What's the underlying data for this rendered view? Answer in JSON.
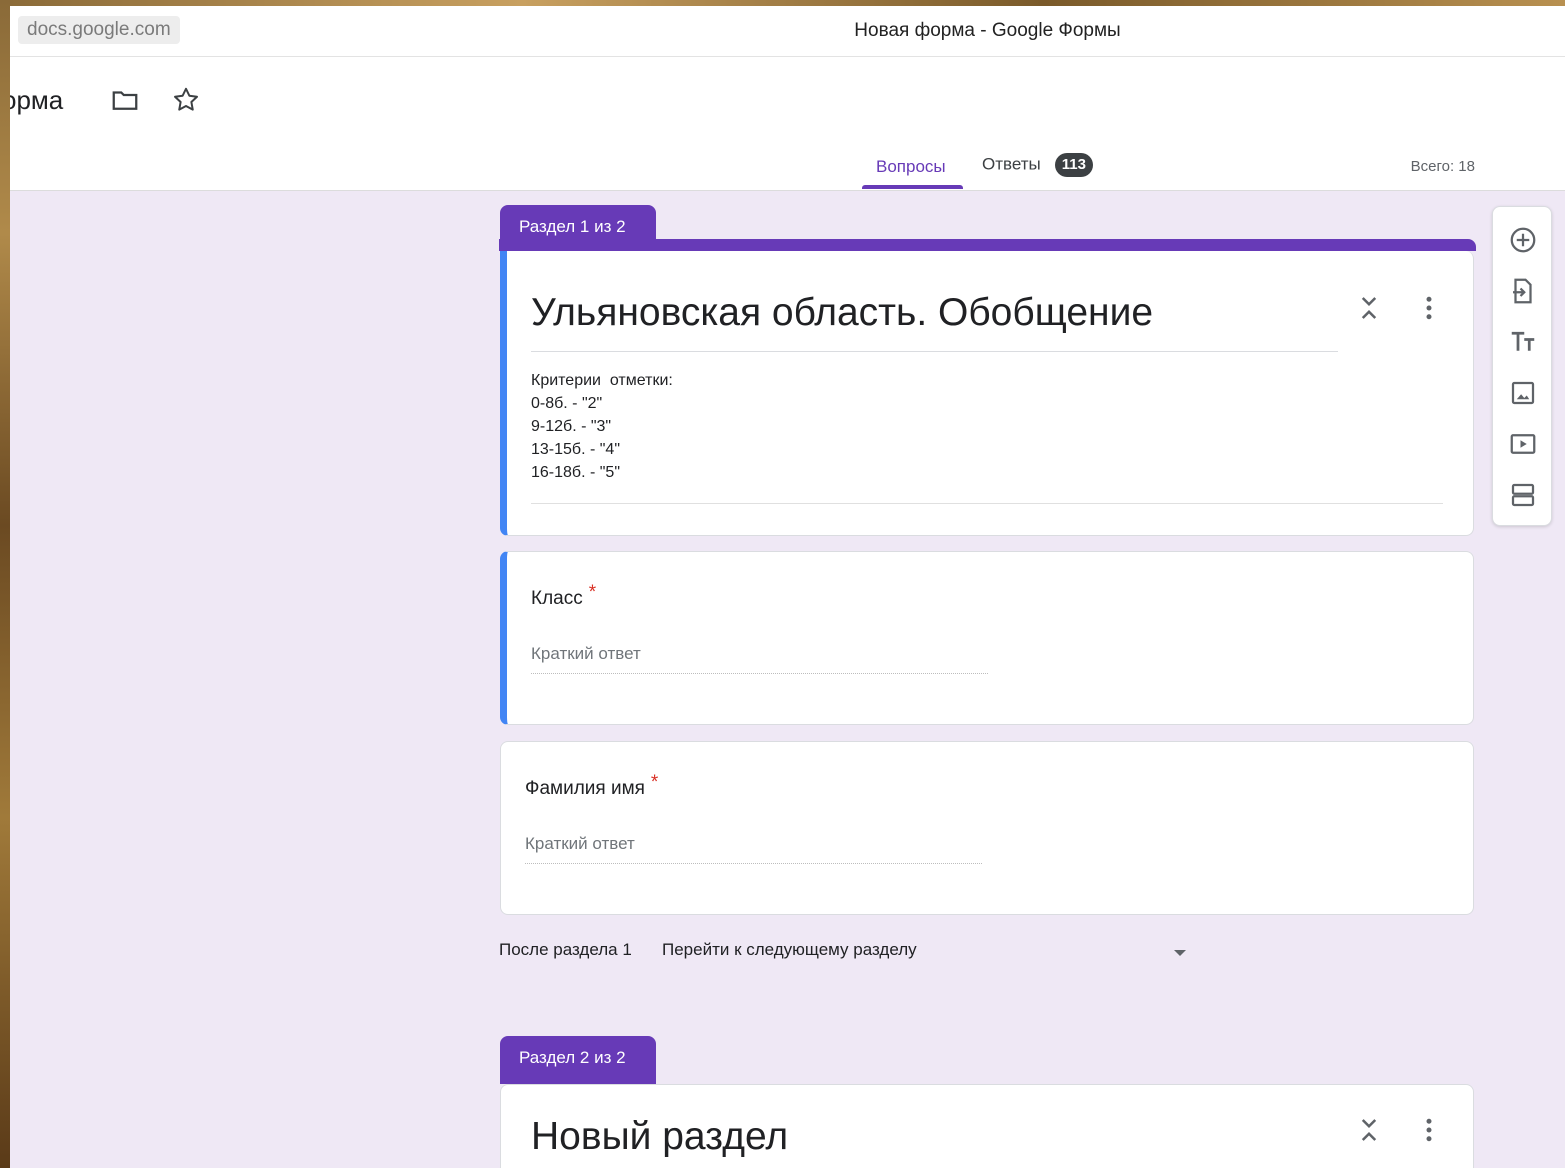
{
  "browser": {
    "url": "docs.google.com",
    "window_title": "Новая форма - Google Формы"
  },
  "header": {
    "doc_title": "орма",
    "folder_icon": "folder-icon",
    "star_icon": "star-icon",
    "tabs": [
      {
        "label": "Вопросы",
        "active": true
      },
      {
        "label": "Ответы",
        "badge": "113"
      }
    ],
    "total": "Всего: 18"
  },
  "section1": {
    "label": "Раздел 1 из 2",
    "title": "Ульяновская область. Обобщение",
    "description": [
      "Критерии  отметки:",
      "0-8б. - \"2\"",
      "9-12б. - \"3\"",
      "13-15б. - \"4\"",
      "16-18б. - \"5\""
    ]
  },
  "questions": [
    {
      "title": "Класс",
      "required": "*",
      "placeholder": "Краткий ответ"
    },
    {
      "title": "Фамилия имя",
      "required": "*",
      "placeholder": "Краткий ответ"
    }
  ],
  "after_section": {
    "label": "После раздела 1",
    "value": "Перейти к следующему разделу"
  },
  "section2": {
    "label": "Раздел 2 из 2",
    "title": "Новый раздел"
  },
  "toolbar": {
    "icons": [
      "add-question-icon",
      "import-questions-icon",
      "add-title-icon",
      "add-image-icon",
      "add-video-icon",
      "add-section-icon"
    ]
  },
  "colors": {
    "accent": "#673ab7",
    "selected_border": "#4285f4",
    "background": "#efe8f5"
  }
}
